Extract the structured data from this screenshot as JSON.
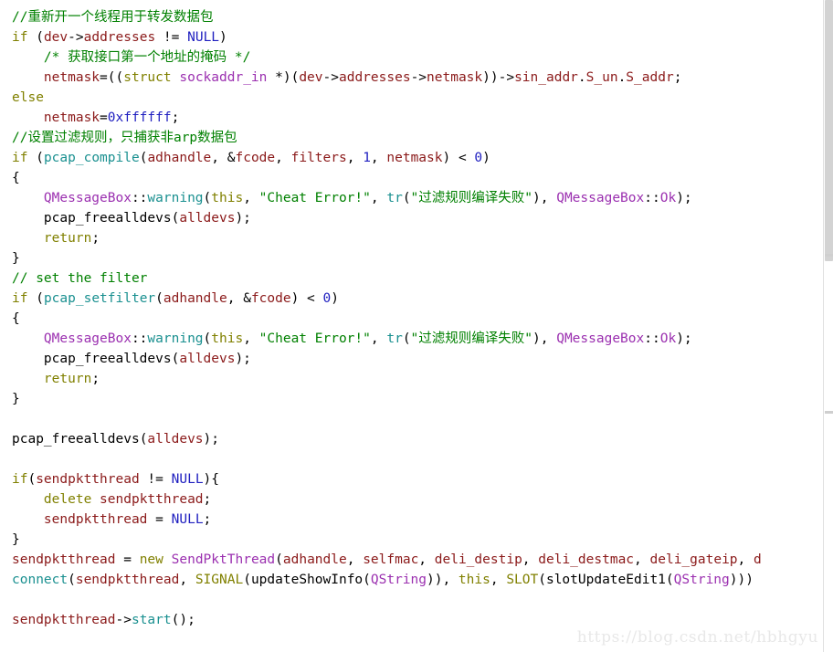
{
  "watermark": {
    "text": "https://blog.csdn.net/hbhgyu"
  },
  "colors": {
    "background": "#ffffff",
    "plain": "#000000",
    "comment": "#008000",
    "keyword": "#808000",
    "identifier": "#8b1a1a",
    "function": "#1a9090",
    "type": "#9b30b0",
    "string": "#008000",
    "number": "#2020c0",
    "scrollbar_track": "#ffffff",
    "scrollbar_thumb": "#d3d3d3",
    "watermark": "#e8e8e8"
  },
  "scrollbar": {
    "name": "vertical-scrollbar",
    "thumb_top_pct": 0,
    "thumb_height_pct": 40,
    "marks_pct": [
      39,
      63
    ]
  },
  "code": {
    "language": "cpp",
    "font_size_px": 14.5,
    "line_height_px": 22,
    "lines": [
      {
        "tokens": [
          {
            "t": "//重新开一个线程用于转发数据包",
            "c": "comment"
          }
        ]
      },
      {
        "tokens": [
          {
            "t": "if",
            "c": "keyword"
          },
          {
            "t": " (",
            "c": "plain"
          },
          {
            "t": "dev",
            "c": "ident"
          },
          {
            "t": "->",
            "c": "plain"
          },
          {
            "t": "addresses",
            "c": "ident"
          },
          {
            "t": " != ",
            "c": "plain"
          },
          {
            "t": "NULL",
            "c": "const"
          },
          {
            "t": ")",
            "c": "plain"
          }
        ]
      },
      {
        "tokens": [
          {
            "t": "    ",
            "c": "plain"
          },
          {
            "t": "/* 获取接口第一个地址的掩码 */",
            "c": "comment"
          }
        ]
      },
      {
        "tokens": [
          {
            "t": "    ",
            "c": "plain"
          },
          {
            "t": "netmask",
            "c": "ident"
          },
          {
            "t": "=((",
            "c": "plain"
          },
          {
            "t": "struct",
            "c": "keyword"
          },
          {
            "t": " ",
            "c": "plain"
          },
          {
            "t": "sockaddr_in",
            "c": "type"
          },
          {
            "t": " *)(",
            "c": "plain"
          },
          {
            "t": "dev",
            "c": "ident"
          },
          {
            "t": "->",
            "c": "plain"
          },
          {
            "t": "addresses",
            "c": "ident"
          },
          {
            "t": "->",
            "c": "plain"
          },
          {
            "t": "netmask",
            "c": "ident"
          },
          {
            "t": "))->",
            "c": "plain"
          },
          {
            "t": "sin_addr",
            "c": "ident"
          },
          {
            "t": ".",
            "c": "plain"
          },
          {
            "t": "S_un",
            "c": "ident"
          },
          {
            "t": ".",
            "c": "plain"
          },
          {
            "t": "S_addr",
            "c": "ident"
          },
          {
            "t": ";",
            "c": "plain"
          }
        ]
      },
      {
        "tokens": [
          {
            "t": "else",
            "c": "keyword"
          }
        ]
      },
      {
        "tokens": [
          {
            "t": "    ",
            "c": "plain"
          },
          {
            "t": "netmask",
            "c": "ident"
          },
          {
            "t": "=",
            "c": "plain"
          },
          {
            "t": "0xffffff",
            "c": "number"
          },
          {
            "t": ";",
            "c": "plain"
          }
        ]
      },
      {
        "tokens": [
          {
            "t": "//设置过滤规则，只捕获非arp数据包",
            "c": "comment"
          }
        ]
      },
      {
        "tokens": [
          {
            "t": "if",
            "c": "keyword"
          },
          {
            "t": " (",
            "c": "plain"
          },
          {
            "t": "pcap_compile",
            "c": "func"
          },
          {
            "t": "(",
            "c": "plain"
          },
          {
            "t": "adhandle",
            "c": "ident"
          },
          {
            "t": ", &",
            "c": "plain"
          },
          {
            "t": "fcode",
            "c": "ident"
          },
          {
            "t": ", ",
            "c": "plain"
          },
          {
            "t": "filters",
            "c": "ident"
          },
          {
            "t": ", ",
            "c": "plain"
          },
          {
            "t": "1",
            "c": "number"
          },
          {
            "t": ", ",
            "c": "plain"
          },
          {
            "t": "netmask",
            "c": "ident"
          },
          {
            "t": ") < ",
            "c": "plain"
          },
          {
            "t": "0",
            "c": "number"
          },
          {
            "t": ")",
            "c": "plain"
          }
        ]
      },
      {
        "tokens": [
          {
            "t": "{",
            "c": "plain"
          }
        ]
      },
      {
        "tokens": [
          {
            "t": "    ",
            "c": "plain"
          },
          {
            "t": "QMessageBox",
            "c": "type"
          },
          {
            "t": "::",
            "c": "plain"
          },
          {
            "t": "warning",
            "c": "func"
          },
          {
            "t": "(",
            "c": "plain"
          },
          {
            "t": "this",
            "c": "keyword"
          },
          {
            "t": ", ",
            "c": "plain"
          },
          {
            "t": "\"Cheat Error!\"",
            "c": "string"
          },
          {
            "t": ", ",
            "c": "plain"
          },
          {
            "t": "tr",
            "c": "func"
          },
          {
            "t": "(",
            "c": "plain"
          },
          {
            "t": "\"过滤规则编译失败\"",
            "c": "string"
          },
          {
            "t": "), ",
            "c": "plain"
          },
          {
            "t": "QMessageBox",
            "c": "type"
          },
          {
            "t": "::",
            "c": "plain"
          },
          {
            "t": "Ok",
            "c": "type"
          },
          {
            "t": ");",
            "c": "plain"
          }
        ]
      },
      {
        "tokens": [
          {
            "t": "    ",
            "c": "plain"
          },
          {
            "t": "pcap_freealldevs",
            "c": "plain"
          },
          {
            "t": "(",
            "c": "plain"
          },
          {
            "t": "alldevs",
            "c": "ident"
          },
          {
            "t": ");",
            "c": "plain"
          }
        ]
      },
      {
        "tokens": [
          {
            "t": "    ",
            "c": "plain"
          },
          {
            "t": "return",
            "c": "keyword"
          },
          {
            "t": ";",
            "c": "plain"
          }
        ]
      },
      {
        "tokens": [
          {
            "t": "}",
            "c": "plain"
          }
        ]
      },
      {
        "tokens": [
          {
            "t": "// set the filter",
            "c": "comment"
          }
        ]
      },
      {
        "tokens": [
          {
            "t": "if",
            "c": "keyword"
          },
          {
            "t": " (",
            "c": "plain"
          },
          {
            "t": "pcap_setfilter",
            "c": "func"
          },
          {
            "t": "(",
            "c": "plain"
          },
          {
            "t": "adhandle",
            "c": "ident"
          },
          {
            "t": ", &",
            "c": "plain"
          },
          {
            "t": "fcode",
            "c": "ident"
          },
          {
            "t": ") < ",
            "c": "plain"
          },
          {
            "t": "0",
            "c": "number"
          },
          {
            "t": ")",
            "c": "plain"
          }
        ]
      },
      {
        "tokens": [
          {
            "t": "{",
            "c": "plain"
          }
        ]
      },
      {
        "tokens": [
          {
            "t": "    ",
            "c": "plain"
          },
          {
            "t": "QMessageBox",
            "c": "type"
          },
          {
            "t": "::",
            "c": "plain"
          },
          {
            "t": "warning",
            "c": "func"
          },
          {
            "t": "(",
            "c": "plain"
          },
          {
            "t": "this",
            "c": "keyword"
          },
          {
            "t": ", ",
            "c": "plain"
          },
          {
            "t": "\"Cheat Error!\"",
            "c": "string"
          },
          {
            "t": ", ",
            "c": "plain"
          },
          {
            "t": "tr",
            "c": "func"
          },
          {
            "t": "(",
            "c": "plain"
          },
          {
            "t": "\"过滤规则编译失败\"",
            "c": "string"
          },
          {
            "t": "), ",
            "c": "plain"
          },
          {
            "t": "QMessageBox",
            "c": "type"
          },
          {
            "t": "::",
            "c": "plain"
          },
          {
            "t": "Ok",
            "c": "type"
          },
          {
            "t": ");",
            "c": "plain"
          }
        ]
      },
      {
        "tokens": [
          {
            "t": "    ",
            "c": "plain"
          },
          {
            "t": "pcap_freealldevs",
            "c": "plain"
          },
          {
            "t": "(",
            "c": "plain"
          },
          {
            "t": "alldevs",
            "c": "ident"
          },
          {
            "t": ");",
            "c": "plain"
          }
        ]
      },
      {
        "tokens": [
          {
            "t": "    ",
            "c": "plain"
          },
          {
            "t": "return",
            "c": "keyword"
          },
          {
            "t": ";",
            "c": "plain"
          }
        ]
      },
      {
        "tokens": [
          {
            "t": "}",
            "c": "plain"
          }
        ]
      },
      {
        "tokens": [
          {
            "t": "",
            "c": "plain"
          }
        ]
      },
      {
        "tokens": [
          {
            "t": "pcap_freealldevs",
            "c": "plain"
          },
          {
            "t": "(",
            "c": "plain"
          },
          {
            "t": "alldevs",
            "c": "ident"
          },
          {
            "t": ");",
            "c": "plain"
          }
        ]
      },
      {
        "tokens": [
          {
            "t": "",
            "c": "plain"
          }
        ]
      },
      {
        "tokens": [
          {
            "t": "if",
            "c": "keyword"
          },
          {
            "t": "(",
            "c": "plain"
          },
          {
            "t": "sendpktthread",
            "c": "ident"
          },
          {
            "t": " != ",
            "c": "plain"
          },
          {
            "t": "NULL",
            "c": "const"
          },
          {
            "t": "){",
            "c": "plain"
          }
        ]
      },
      {
        "tokens": [
          {
            "t": "    ",
            "c": "plain"
          },
          {
            "t": "delete",
            "c": "keyword"
          },
          {
            "t": " ",
            "c": "plain"
          },
          {
            "t": "sendpktthread",
            "c": "ident"
          },
          {
            "t": ";",
            "c": "plain"
          }
        ]
      },
      {
        "tokens": [
          {
            "t": "    ",
            "c": "plain"
          },
          {
            "t": "sendpktthread",
            "c": "ident"
          },
          {
            "t": " = ",
            "c": "plain"
          },
          {
            "t": "NULL",
            "c": "const"
          },
          {
            "t": ";",
            "c": "plain"
          }
        ]
      },
      {
        "tokens": [
          {
            "t": "}",
            "c": "plain"
          }
        ]
      },
      {
        "tokens": [
          {
            "t": "sendpktthread",
            "c": "ident"
          },
          {
            "t": " = ",
            "c": "plain"
          },
          {
            "t": "new",
            "c": "keyword"
          },
          {
            "t": " ",
            "c": "plain"
          },
          {
            "t": "SendPktThread",
            "c": "type"
          },
          {
            "t": "(",
            "c": "plain"
          },
          {
            "t": "adhandle",
            "c": "ident"
          },
          {
            "t": ", ",
            "c": "plain"
          },
          {
            "t": "selfmac",
            "c": "ident"
          },
          {
            "t": ", ",
            "c": "plain"
          },
          {
            "t": "deli_destip",
            "c": "ident"
          },
          {
            "t": ", ",
            "c": "plain"
          },
          {
            "t": "deli_destmac",
            "c": "ident"
          },
          {
            "t": ", ",
            "c": "plain"
          },
          {
            "t": "deli_gateip",
            "c": "ident"
          },
          {
            "t": ", ",
            "c": "plain"
          },
          {
            "t": "d",
            "c": "ident"
          }
        ]
      },
      {
        "tokens": [
          {
            "t": "connect",
            "c": "func"
          },
          {
            "t": "(",
            "c": "plain"
          },
          {
            "t": "sendpktthread",
            "c": "ident"
          },
          {
            "t": ", ",
            "c": "plain"
          },
          {
            "t": "SIGNAL",
            "c": "macro"
          },
          {
            "t": "(",
            "c": "plain"
          },
          {
            "t": "updateShowInfo",
            "c": "plain"
          },
          {
            "t": "(",
            "c": "plain"
          },
          {
            "t": "QString",
            "c": "type"
          },
          {
            "t": ")), ",
            "c": "plain"
          },
          {
            "t": "this",
            "c": "keyword"
          },
          {
            "t": ", ",
            "c": "plain"
          },
          {
            "t": "SLOT",
            "c": "macro"
          },
          {
            "t": "(",
            "c": "plain"
          },
          {
            "t": "slotUpdateEdit1",
            "c": "plain"
          },
          {
            "t": "(",
            "c": "plain"
          },
          {
            "t": "QString",
            "c": "type"
          },
          {
            "t": ")))",
            "c": "plain"
          }
        ]
      },
      {
        "tokens": [
          {
            "t": "",
            "c": "plain"
          }
        ]
      },
      {
        "tokens": [
          {
            "t": "sendpktthread",
            "c": "ident"
          },
          {
            "t": "->",
            "c": "plain"
          },
          {
            "t": "start",
            "c": "func"
          },
          {
            "t": "();",
            "c": "plain"
          }
        ]
      }
    ]
  }
}
